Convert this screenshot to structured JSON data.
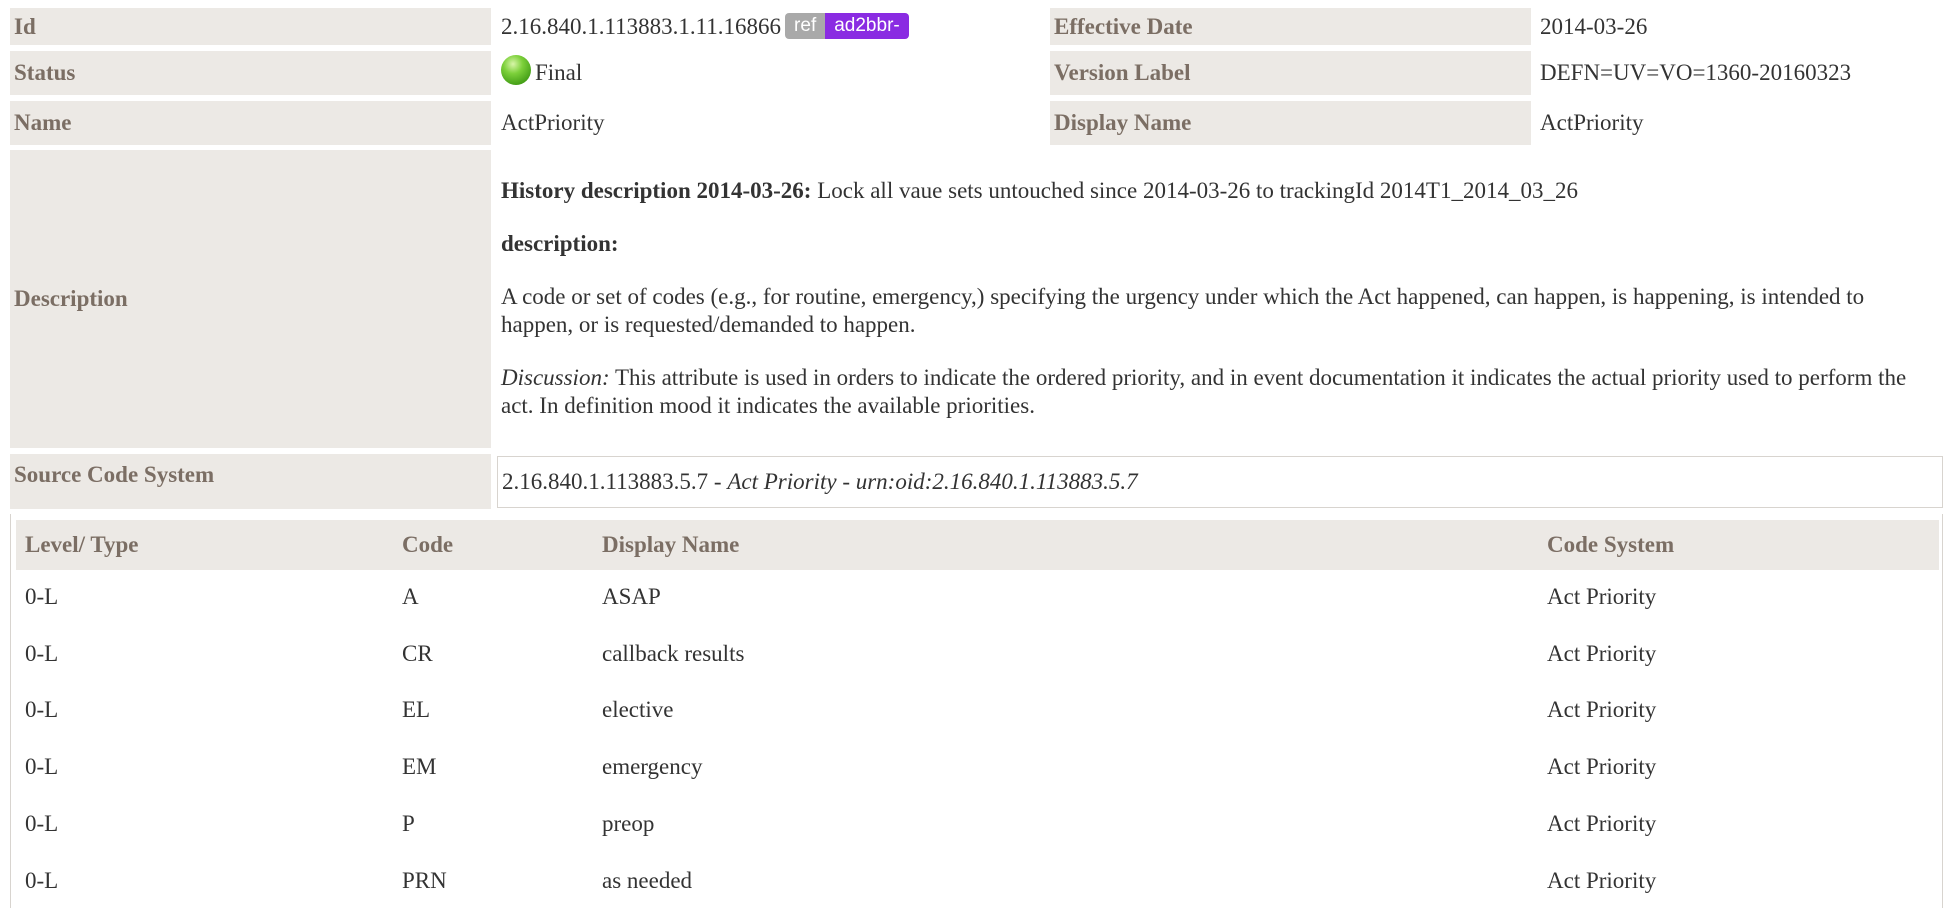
{
  "id": {
    "label": "Id",
    "value": "2.16.840.1.113883.1.11.16866",
    "badge_ref": "ref",
    "badge_prefix": "ad2bbr-"
  },
  "effective_date": {
    "label": "Effective Date",
    "value": "2014-03-26"
  },
  "status": {
    "label": "Status",
    "value": "Final",
    "icon": "status-final-green-dot",
    "color": "#5bb52a"
  },
  "version_label": {
    "label": "Version Label",
    "value": "DEFN=UV=VO=1360-20160323"
  },
  "name": {
    "label": "Name",
    "value": "ActPriority"
  },
  "display_name": {
    "label": "Display Name",
    "value": "ActPriority"
  },
  "description": {
    "label": "Description",
    "history_heading": "History description 2014-03-26:",
    "history_text": " Lock all vaue sets untouched since 2014-03-26 to trackingId 2014T1_2014_03_26",
    "desc_heading": "description:",
    "paragraph": "A code or set of codes (e.g., for routine, emergency,) specifying the urgency under which the Act happened, can happen, is happening, is intended to happen, or is requested/demanded to happen.",
    "discussion_label": "Discussion:",
    "discussion_text": " This attribute is used in orders to indicate the ordered priority, and in event documentation it indicates the actual priority used to perform the act. In definition mood it indicates the available priorities."
  },
  "source_code_system": {
    "label": "Source Code System",
    "oid": "2.16.840.1.113883.5.7",
    "sep1": " - ",
    "name": "Act Priority",
    "sep2": " - ",
    "urn": "urn:oid:2.16.840.1.113883.5.7"
  },
  "concept_table": {
    "headers": [
      "Level/ Type",
      "Code",
      "Display Name",
      "Code System"
    ],
    "rows": [
      [
        "0-L",
        "A",
        "ASAP",
        "Act Priority"
      ],
      [
        "0-L",
        "CR",
        "callback results",
        "Act Priority"
      ],
      [
        "0-L",
        "EL",
        "elective",
        "Act Priority"
      ],
      [
        "0-L",
        "EM",
        "emergency",
        "Act Priority"
      ],
      [
        "0-L",
        "P",
        "preop",
        "Act Priority"
      ],
      [
        "0-L",
        "PRN",
        "as needed",
        "Act Priority"
      ]
    ]
  },
  "colors": {
    "label_bg": "#ece9e5",
    "label_text": "#7b6e64",
    "ref_badge": "#a9a9a9",
    "prefix_badge": "#8a2be2"
  }
}
